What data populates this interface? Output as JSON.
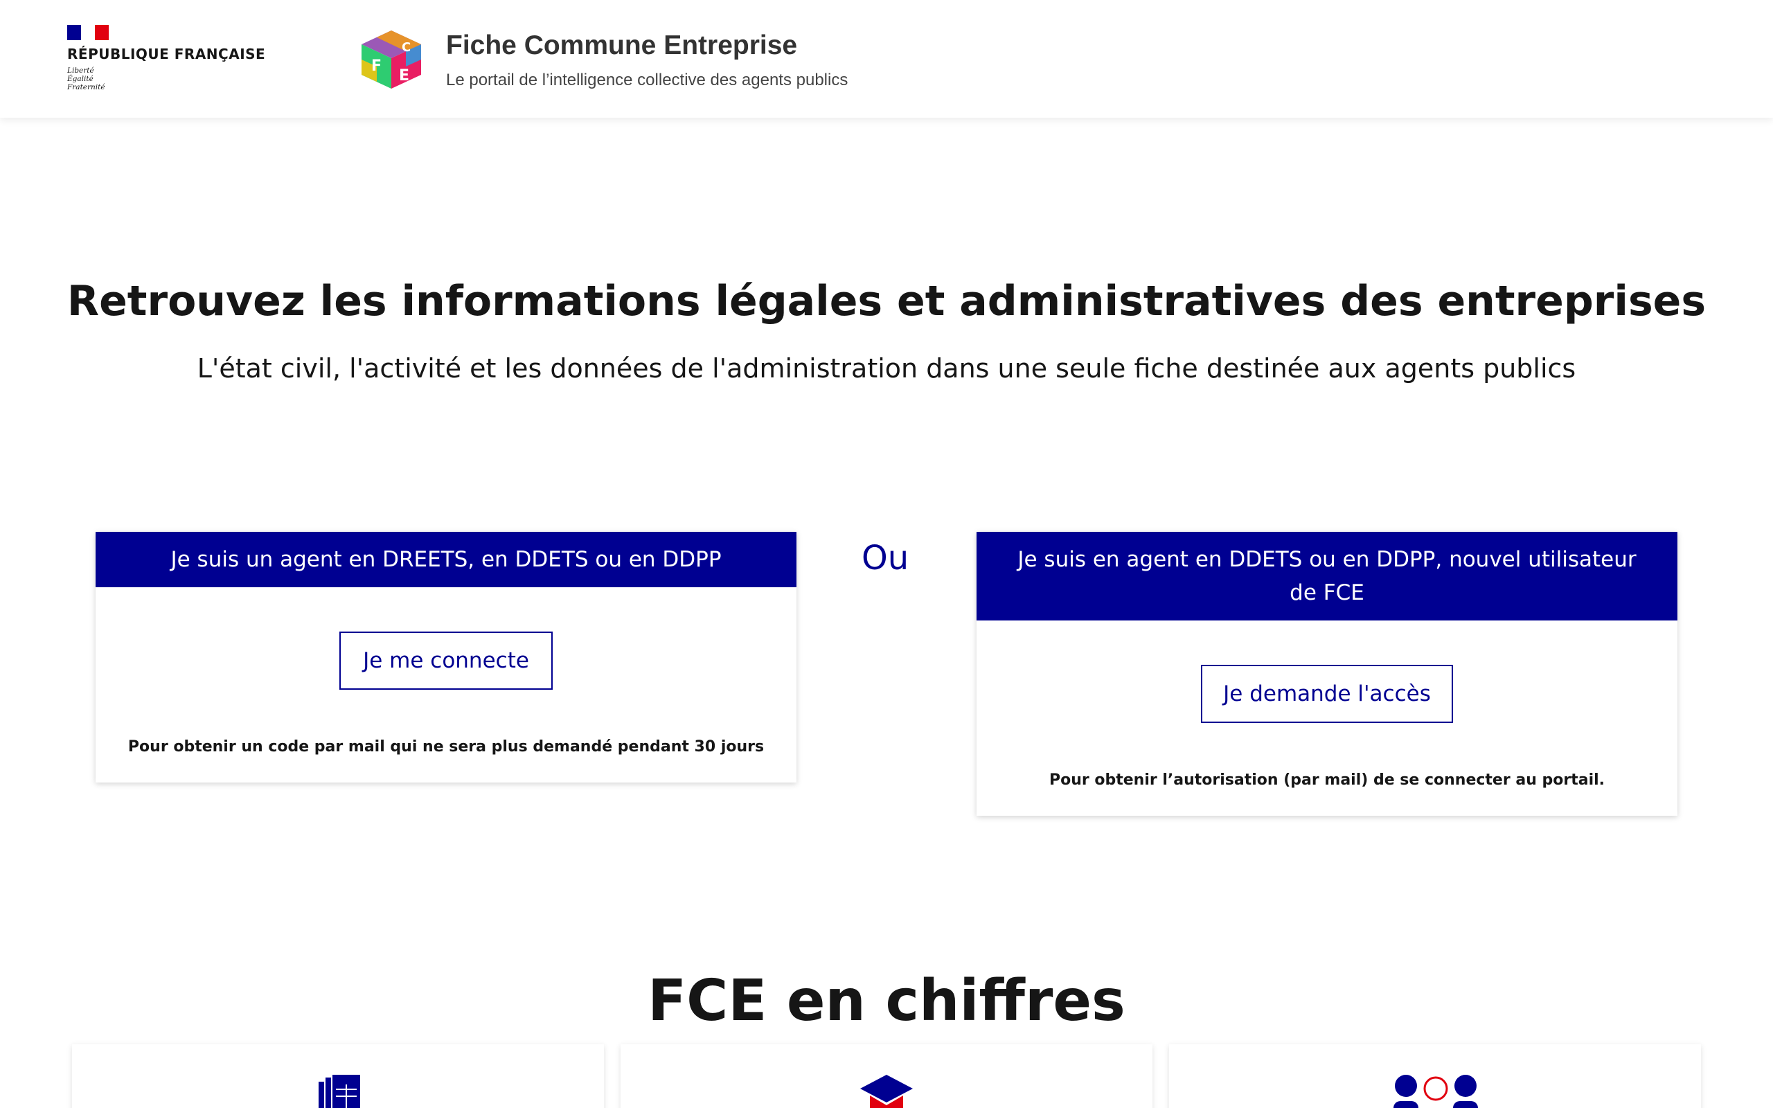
{
  "header": {
    "republic_name": "RÉPUBLIQUE FRANÇAISE",
    "motto": [
      "Liberté",
      "Égalité",
      "Fraternité"
    ],
    "app_title": "Fiche Commune Entreprise",
    "app_subtitle": "Le portail de l’intelligence collective des agents publics",
    "logo_letters": [
      "F",
      "C",
      "E"
    ]
  },
  "hero": {
    "title": "Retrouvez les informations légales et administratives des entreprises",
    "subtitle": "L'état civil, l'activité et les données de l'administration dans une seule fiche destinée aux agents publics"
  },
  "login_cards": {
    "or_label": "Ou",
    "existing_agent": {
      "heading": "Je suis un agent en DREETS, en DDETS ou en DDPP",
      "button_label": "Je me connecte",
      "note": "Pour obtenir un code par mail qui ne sera plus demandé pendant 30 jours"
    },
    "new_user": {
      "heading": "Je suis en agent en DDETS ou en DDPP, nouvel utilisateur de FCE",
      "button_label": "Je demande l'accès",
      "note": "Pour obtenir l’autorisation (par mail) de se connecter au portail."
    }
  },
  "stats": {
    "title": "FCE en chiffres",
    "cards": [
      {
        "icon": "spreadsheet-icon"
      },
      {
        "icon": "graduation-cap-icon"
      },
      {
        "icon": "users-group-icon"
      }
    ]
  },
  "colors": {
    "primary_blue": "#000091",
    "marianne_red": "#e1000f",
    "text": "#161616"
  }
}
